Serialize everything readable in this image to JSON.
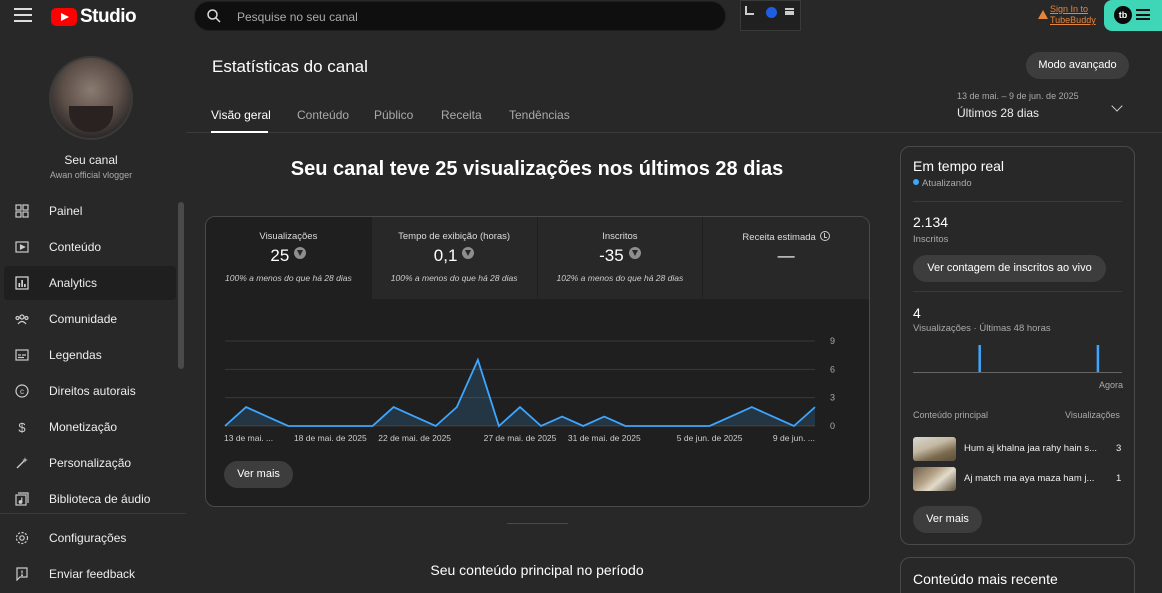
{
  "app": {
    "logo_text": "Studio"
  },
  "search": {
    "placeholder": "Pesquise no seu canal"
  },
  "tubebuddy": {
    "sign_in": "Sign In to TubeBuddy",
    "logo": "tb"
  },
  "channel": {
    "name": "Seu canal",
    "subtitle": "Awan official vlogger"
  },
  "sidebar": {
    "items": [
      {
        "label": "Painel",
        "icon": "dashboard-icon"
      },
      {
        "label": "Conteúdo",
        "icon": "content-icon"
      },
      {
        "label": "Analytics",
        "icon": "analytics-icon",
        "active": true
      },
      {
        "label": "Comunidade",
        "icon": "community-icon"
      },
      {
        "label": "Legendas",
        "icon": "subtitles-icon"
      },
      {
        "label": "Direitos autorais",
        "icon": "copyright-icon"
      },
      {
        "label": "Monetização",
        "icon": "monetization-icon"
      },
      {
        "label": "Personalização",
        "icon": "customization-icon"
      },
      {
        "label": "Biblioteca de áudio",
        "icon": "audio-library-icon"
      }
    ],
    "footer": [
      {
        "label": "Configurações",
        "icon": "settings-icon"
      },
      {
        "label": "Enviar feedback",
        "icon": "feedback-icon"
      }
    ]
  },
  "page": {
    "title": "Estatísticas do canal",
    "advanced_button": "Modo avançado",
    "tabs": [
      "Visão geral",
      "Conteúdo",
      "Público",
      "Receita",
      "Tendências"
    ],
    "active_tab": "Visão geral",
    "date_range": {
      "dates": "13 de mai. – 9 de jun. de 2025",
      "label": "Últimos 28 dias"
    }
  },
  "overview": {
    "headline": "Seu canal teve 25 visualizações nos últimos 28 dias",
    "metrics": [
      {
        "label": "Visualizações",
        "value": "25",
        "trend": "down",
        "note": "100% a menos do que há 28 dias"
      },
      {
        "label": "Tempo de exibição (horas)",
        "value": "0,1",
        "trend": "down",
        "note": "100% a menos do que há 28 dias"
      },
      {
        "label": "Inscritos",
        "value": "-35",
        "trend": "down",
        "note": "102% a menos do que há 28 dias"
      },
      {
        "label": "Receita estimada",
        "value": "—",
        "info_icon": "info-icon",
        "note": ""
      }
    ],
    "more_button": "Ver mais",
    "top_content_title": "Seu conteúdo principal no período"
  },
  "chart_data": {
    "type": "area",
    "color": "#3ea6ff",
    "x_tick_labels": [
      "13 de mai. ...",
      "18 de mai. de 2025",
      "22 de mai. de 2025",
      "27 de mai. de 2025",
      "31 de mai. de 2025",
      "5 de jun. de 2025",
      "9 de jun. ..."
    ],
    "y_ticks": [
      0,
      3,
      6,
      9
    ],
    "ylim": [
      0,
      9
    ],
    "series": [
      {
        "values": [
          0,
          2,
          1,
          0,
          0,
          0,
          0,
          0,
          2,
          1,
          0,
          2,
          7,
          0,
          2,
          0,
          1,
          0,
          1,
          0,
          0,
          0,
          0,
          0,
          1,
          2,
          1,
          0,
          2
        ]
      }
    ]
  },
  "realtime": {
    "title": "Em tempo real",
    "status": "Atualizando",
    "subscribers_value": "2.134",
    "subscribers_label": "Inscritos",
    "live_count_button": "Ver contagem de inscritos ao vivo",
    "views_value": "4",
    "views_label": "Visualizações · Últimas 48 horas",
    "now_label": "Agora",
    "bars": [
      0,
      0,
      0,
      0,
      0,
      0,
      0,
      0,
      0,
      0,
      0,
      0,
      0,
      0,
      0,
      0,
      0,
      0,
      0,
      0,
      0,
      0,
      0,
      0,
      0,
      0,
      0,
      0,
      0,
      0,
      0,
      0,
      0,
      0,
      0,
      0,
      0,
      0,
      0,
      0,
      0,
      0,
      0,
      0,
      0,
      0,
      0,
      0,
      0,
      0,
      0,
      0,
      0,
      0,
      0,
      0,
      0,
      0,
      0,
      0,
      0,
      0,
      1,
      0,
      0,
      0,
      0,
      0,
      0,
      0,
      0,
      0,
      0,
      0,
      0,
      0,
      0,
      0,
      0,
      0,
      0,
      0,
      0,
      0,
      0,
      0,
      0,
      0,
      0,
      0,
      0,
      0,
      0,
      0,
      0,
      0,
      0,
      0,
      0,
      0,
      0,
      0,
      0,
      0,
      0,
      0,
      0,
      0,
      0,
      0,
      0,
      0,
      0,
      0,
      0,
      0,
      0,
      0,
      0,
      0,
      0,
      0,
      0,
      0,
      0,
      0,
      0,
      0,
      0,
      0,
      0,
      0,
      0,
      0,
      0,
      0,
      0,
      0,
      0,
      0,
      0,
      0,
      0,
      0,
      0,
      0,
      0,
      0,
      0,
      0,
      0,
      0,
      0,
      0,
      0,
      0,
      0,
      0,
      0,
      0,
      0,
      0,
      0,
      0,
      0,
      0,
      0,
      0,
      0,
      0,
      0,
      0,
      0,
      0,
      1,
      0,
      0,
      0,
      0,
      0,
      0,
      0,
      0,
      0,
      0,
      0,
      0,
      0,
      0,
      0,
      0,
      0,
      0,
      0,
      0,
      0,
      0,
      0
    ],
    "content_header_left": "Conteúdo principal",
    "content_header_right": "Visualizações",
    "videos": [
      {
        "title": "Hum aj khalna jaa rahy hain s...",
        "views": "3"
      },
      {
        "title": "Aj match ma aya maza ham j...",
        "views": "1"
      }
    ],
    "more_button": "Ver mais"
  },
  "recent": {
    "title": "Conteúdo mais recente"
  }
}
